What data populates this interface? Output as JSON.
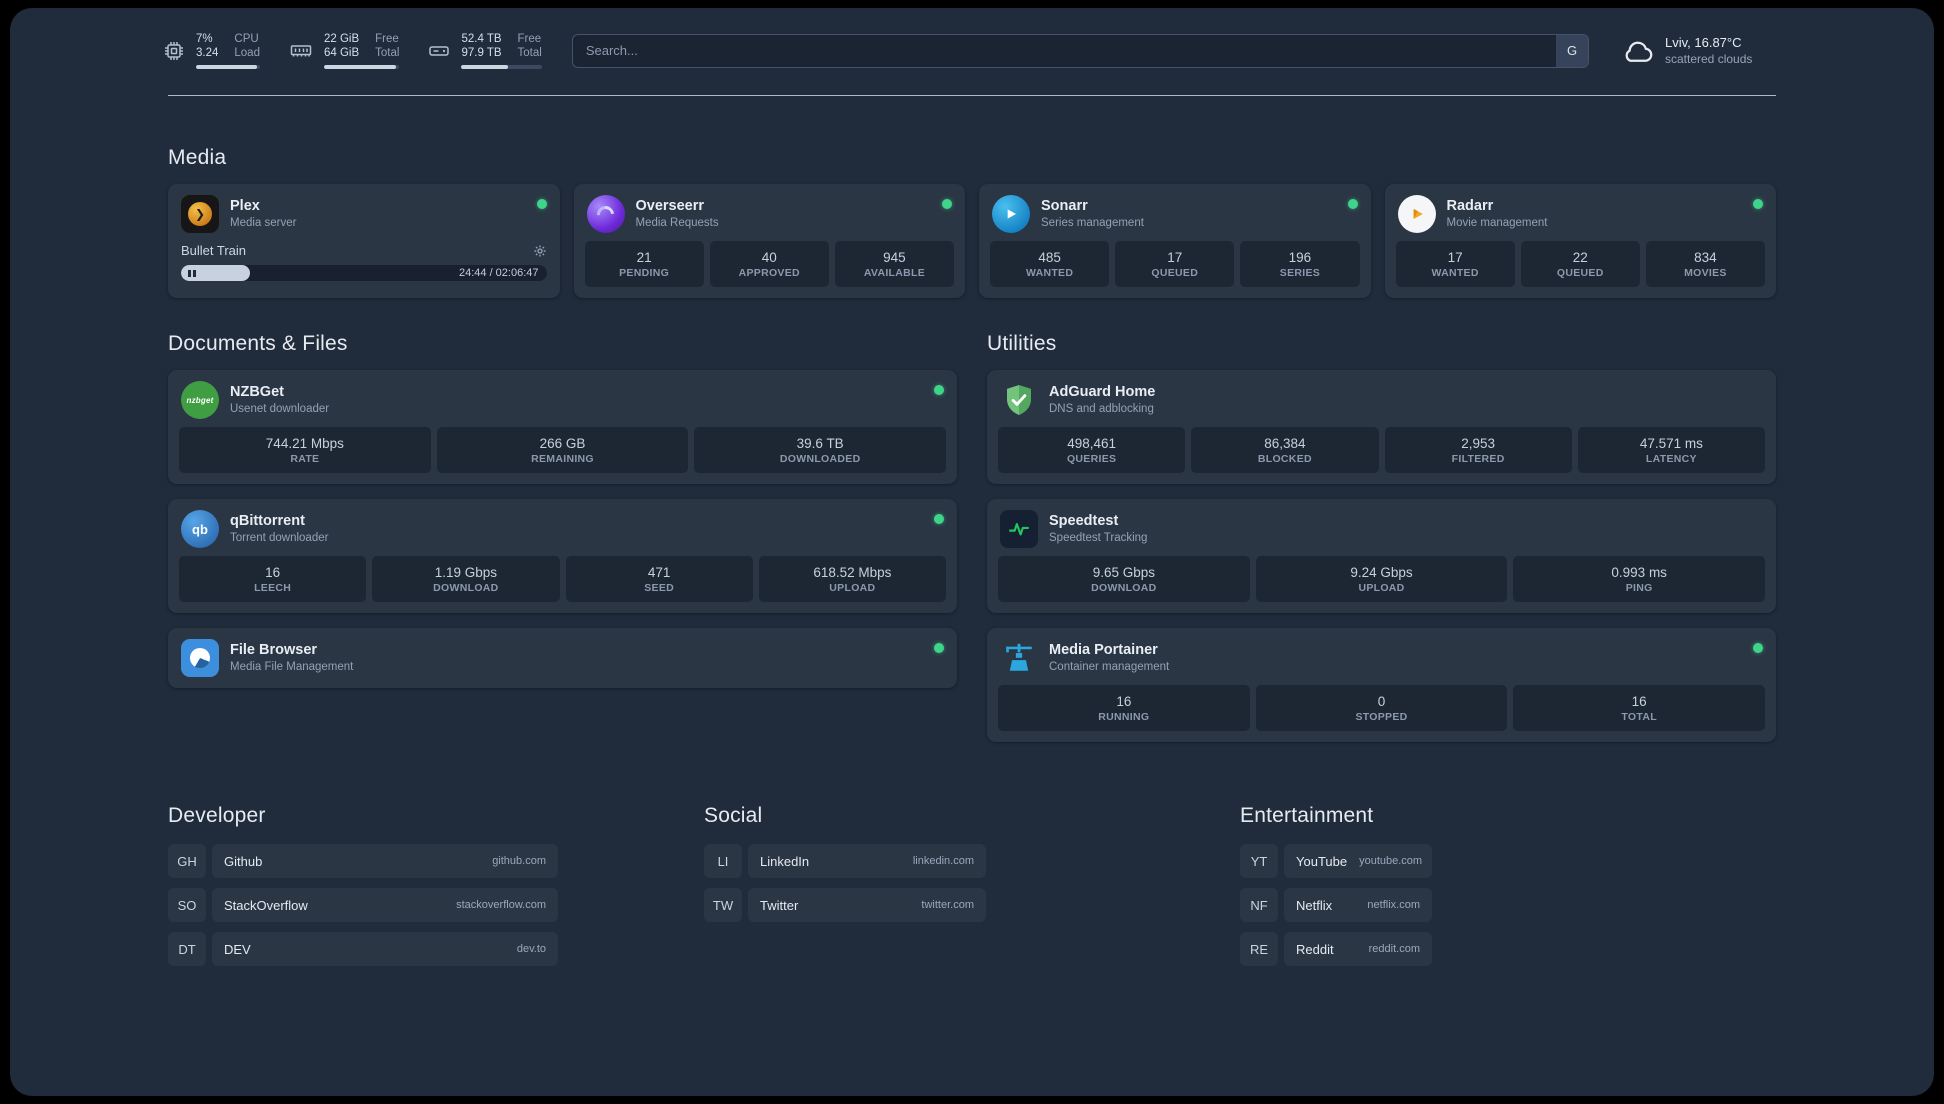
{
  "topbar": {
    "cpu": {
      "value_top": "7%",
      "value_bottom": "3.24",
      "label_top": "CPU",
      "label_bottom": "Load",
      "bar_pct": 95
    },
    "memory": {
      "value_top": "22 GiB",
      "value_bottom": "64 GiB",
      "label_top": "Free",
      "label_bottom": "Total",
      "bar_pct": 95
    },
    "disk": {
      "value_top": "52.4 TB",
      "value_bottom": "97.9 TB",
      "label_top": "Free",
      "label_bottom": "Total",
      "bar_pct": 58
    },
    "search": {
      "placeholder": "Search...",
      "provider_button": "G"
    },
    "weather": {
      "location": "Lviv, 16.87°C",
      "condition": "scattered clouds"
    }
  },
  "sections": {
    "media": {
      "title": "Media"
    },
    "documents": {
      "title": "Documents & Files"
    },
    "utilities": {
      "title": "Utilities"
    },
    "developer": {
      "title": "Developer"
    },
    "social": {
      "title": "Social"
    },
    "entertainment": {
      "title": "Entertainment"
    }
  },
  "services": {
    "plex": {
      "name": "Plex",
      "desc": "Media server",
      "now_playing": "Bullet Train",
      "time": "24:44 / 02:06:47",
      "progress_pct": 19
    },
    "overseerr": {
      "name": "Overseerr",
      "desc": "Media Requests",
      "stats": [
        {
          "value": "21",
          "label": "PENDING"
        },
        {
          "value": "40",
          "label": "APPROVED"
        },
        {
          "value": "945",
          "label": "AVAILABLE"
        }
      ]
    },
    "sonarr": {
      "name": "Sonarr",
      "desc": "Series management",
      "stats": [
        {
          "value": "485",
          "label": "WANTED"
        },
        {
          "value": "17",
          "label": "QUEUED"
        },
        {
          "value": "196",
          "label": "SERIES"
        }
      ]
    },
    "radarr": {
      "name": "Radarr",
      "desc": "Movie management",
      "stats": [
        {
          "value": "17",
          "label": "WANTED"
        },
        {
          "value": "22",
          "label": "QUEUED"
        },
        {
          "value": "834",
          "label": "MOVIES"
        }
      ]
    },
    "nzbget": {
      "name": "NZBGet",
      "desc": "Usenet downloader",
      "icon_text": "nzbget",
      "stats": [
        {
          "value": "744.21 Mbps",
          "label": "RATE"
        },
        {
          "value": "266 GB",
          "label": "REMAINING"
        },
        {
          "value": "39.6 TB",
          "label": "DOWNLOADED"
        }
      ]
    },
    "qbittorrent": {
      "name": "qBittorrent",
      "desc": "Torrent downloader",
      "icon_text": "qb",
      "stats": [
        {
          "value": "16",
          "label": "LEECH"
        },
        {
          "value": "1.19 Gbps",
          "label": "DOWNLOAD"
        },
        {
          "value": "471",
          "label": "SEED"
        },
        {
          "value": "618.52 Mbps",
          "label": "UPLOAD"
        }
      ]
    },
    "filebrowser": {
      "name": "File Browser",
      "desc": "Media File Management"
    },
    "adguard": {
      "name": "AdGuard Home",
      "desc": "DNS and adblocking",
      "stats": [
        {
          "value": "498,461",
          "label": "QUERIES"
        },
        {
          "value": "86,384",
          "label": "BLOCKED"
        },
        {
          "value": "2,953",
          "label": "FILTERED"
        },
        {
          "value": "47.571 ms",
          "label": "LATENCY"
        }
      ]
    },
    "speedtest": {
      "name": "Speedtest",
      "desc": "Speedtest Tracking",
      "stats": [
        {
          "value": "9.65 Gbps",
          "label": "DOWNLOAD"
        },
        {
          "value": "9.24 Gbps",
          "label": "UPLOAD"
        },
        {
          "value": "0.993 ms",
          "label": "PING"
        }
      ]
    },
    "portainer": {
      "name": "Media Portainer",
      "desc": "Container management",
      "stats": [
        {
          "value": "16",
          "label": "RUNNING"
        },
        {
          "value": "0",
          "label": "STOPPED"
        },
        {
          "value": "16",
          "label": "TOTAL"
        }
      ]
    }
  },
  "bookmarks": {
    "developer": [
      {
        "abbr": "GH",
        "name": "Github",
        "domain": "github.com"
      },
      {
        "abbr": "SO",
        "name": "StackOverflow",
        "domain": "stackoverflow.com"
      },
      {
        "abbr": "DT",
        "name": "DEV",
        "domain": "dev.to"
      }
    ],
    "social": [
      {
        "abbr": "LI",
        "name": "LinkedIn",
        "domain": "linkedin.com"
      },
      {
        "abbr": "TW",
        "name": "Twitter",
        "domain": "twitter.com"
      }
    ],
    "entertainment": [
      {
        "abbr": "YT",
        "name": "YouTube",
        "domain": "youtube.com"
      },
      {
        "abbr": "NF",
        "name": "Netflix",
        "domain": "netflix.com"
      },
      {
        "abbr": "RE",
        "name": "Reddit",
        "domain": "reddit.com"
      }
    ]
  }
}
